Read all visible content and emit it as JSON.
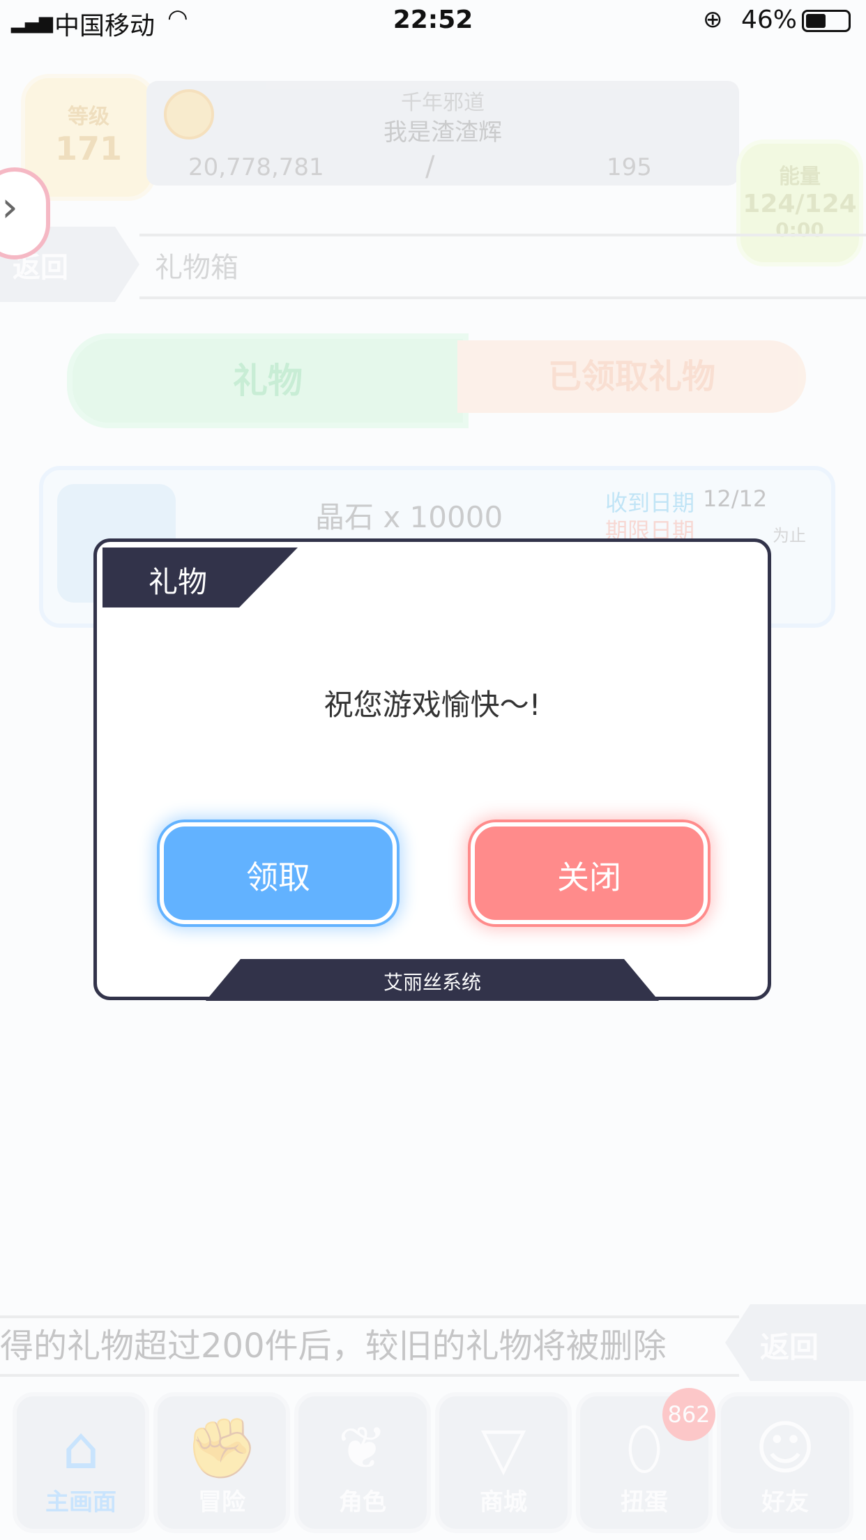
{
  "status_bar": {
    "carrier": "中国移动",
    "time": "22:52",
    "battery": "46%"
  },
  "hud": {
    "level_label": "等级",
    "level_value": "171",
    "title": "千年邪道",
    "player_name": "我是渣渣辉",
    "gold": "20,778,781",
    "slash": "/",
    "gems": "195",
    "energy_label": "能量",
    "energy_value": "124/124",
    "energy_timer": "0:00"
  },
  "nav_bar": {
    "back_label": "返回",
    "page_title": "礼物箱"
  },
  "tabs": [
    {
      "label": "礼物"
    },
    {
      "label": "已领取礼物"
    }
  ],
  "gift_item": {
    "name": "晶石 x 10000",
    "received_label": "收到日期",
    "received_value": "12/12",
    "deadline_label": "期限日期",
    "until": "为止"
  },
  "notice": {
    "text": "得的礼物超过200件后，较旧的礼物将被删除",
    "back_label": "返回"
  },
  "bottom_nav": [
    {
      "label": "主画面",
      "icon": "home-icon"
    },
    {
      "label": "冒险",
      "icon": "handshake-icon"
    },
    {
      "label": "角色",
      "icon": "rabbit-icon"
    },
    {
      "label": "商城",
      "icon": "cart-icon"
    },
    {
      "label": "扭蛋",
      "icon": "egg-icon"
    },
    {
      "label": "好友",
      "icon": "friends-icon"
    }
  ],
  "gacha_badge": "862",
  "dialog": {
    "title": "礼物",
    "message": "祝您游戏愉快～!",
    "claim_label": "领取",
    "close_label": "关闭",
    "footer": "艾丽丝系统"
  },
  "colors": {
    "dialog_dark": "#32334a",
    "claim": "#62b2ff",
    "close": "#ff8b8b",
    "tab_gift": "#5fcf83",
    "tab_received": "#f5a57a"
  }
}
